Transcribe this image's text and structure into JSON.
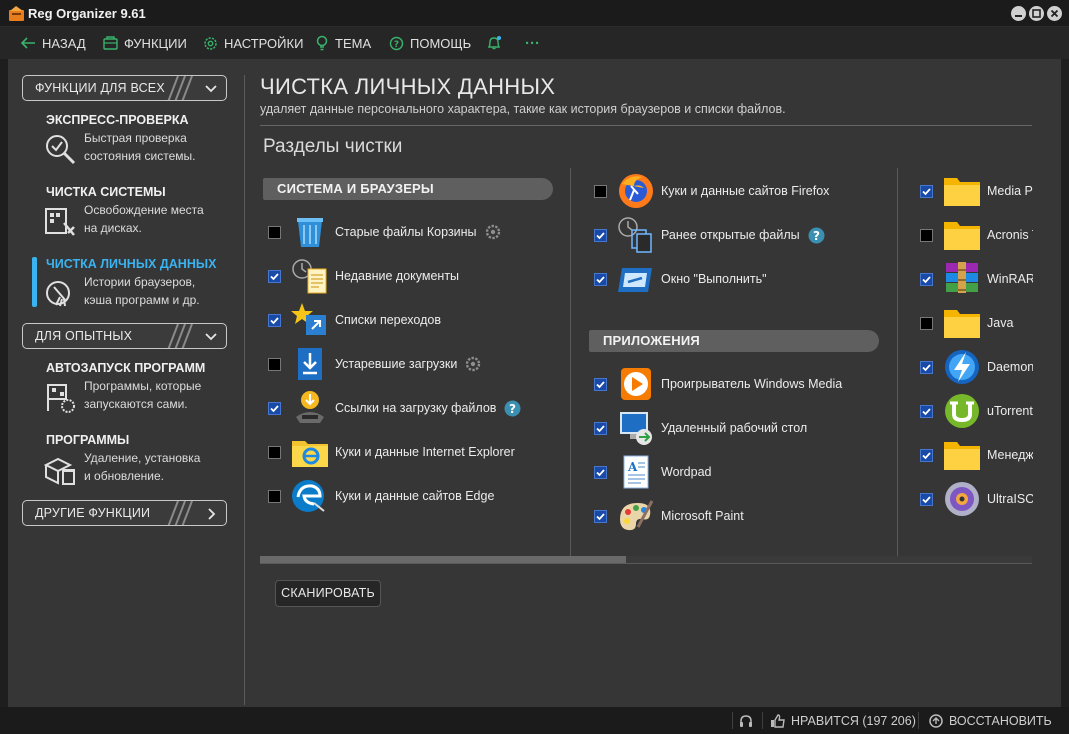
{
  "window": {
    "title": "Reg Organizer 9.61"
  },
  "toolbar": {
    "back": "НАЗАД",
    "functions": "ФУНКЦИИ",
    "settings": "НАСТРОЙКИ",
    "theme": "ТЕМА",
    "help": "ПОМОЩЬ",
    "more": "···"
  },
  "sidebar": {
    "section_all": "ФУНКЦИИ ДЛЯ ВСЕХ",
    "section_experienced": "ДЛЯ ОПЫТНЫХ",
    "section_other": "ДРУГИЕ ФУНКЦИИ",
    "items": [
      {
        "title": "ЭКСПРЕСС-ПРОВЕРКА",
        "desc1": "Быстрая проверка",
        "desc2": "состояния системы."
      },
      {
        "title": "ЧИСТКА СИСТЕМЫ",
        "desc1": "Освобождение места",
        "desc2": "на дисках."
      },
      {
        "title": "ЧИСТКА ЛИЧНЫХ ДАННЫХ",
        "desc1": "Истории браузеров,",
        "desc2": "кэша программ и др."
      },
      {
        "title": "АВТОЗАПУСК ПРОГРАММ",
        "desc1": "Программы, которые",
        "desc2": "запускаются сами."
      },
      {
        "title": "ПРОГРАММЫ",
        "desc1": "Удаление, установка",
        "desc2": "и обновление."
      }
    ]
  },
  "main": {
    "title": "ЧИСТКА ЛИЧНЫХ ДАННЫХ",
    "subtitle": "удаляет данные персонального характера, такие как история браузеров и списки файлов.",
    "sections_heading": "Разделы чистки",
    "group_system": "СИСТЕМА И БРАУЗЕРЫ",
    "group_apps": "ПРИЛОЖЕНИЯ",
    "col1": [
      {
        "label": "Старые файлы Корзины",
        "checked": false,
        "icon": "recycle-bin-icon"
      },
      {
        "label": "Недавние документы",
        "checked": true,
        "icon": "recent-docs-icon"
      },
      {
        "label": "Списки переходов",
        "checked": true,
        "icon": "jump-list-icon"
      },
      {
        "label": "Устаревшие загрузки",
        "checked": false,
        "icon": "downloads-icon"
      },
      {
        "label": "Ссылки на загрузку файлов",
        "checked": true,
        "icon": "download-links-icon"
      },
      {
        "label": "Куки и данные Internet Explorer",
        "checked": false,
        "icon": "ie-folder-icon"
      },
      {
        "label": "Куки и данные сайтов Edge",
        "checked": false,
        "icon": "edge-icon"
      }
    ],
    "col2_top": [
      {
        "label": "Куки и данные сайтов Firefox",
        "checked": false,
        "icon": "firefox-icon"
      },
      {
        "label": "Ранее открытые файлы",
        "checked": true,
        "icon": "opened-files-icon"
      },
      {
        "label": "Окно \"Выполнить\"",
        "checked": true,
        "icon": "run-dialog-icon"
      }
    ],
    "col2_apps": [
      {
        "label": "Проигрыватель Windows Media",
        "checked": true,
        "icon": "wmp-icon"
      },
      {
        "label": "Удаленный рабочий стол",
        "checked": true,
        "icon": "remote-desktop-icon"
      },
      {
        "label": "Wordpad",
        "checked": true,
        "icon": "wordpad-icon"
      },
      {
        "label": "Microsoft Paint",
        "checked": true,
        "icon": "paint-icon"
      }
    ],
    "col3": [
      {
        "label": "Media Pla",
        "checked": true,
        "icon": "folder-icon"
      },
      {
        "label": "Acronis Tr",
        "checked": false,
        "icon": "folder-icon"
      },
      {
        "label": "WinRAR",
        "checked": true,
        "icon": "winrar-icon"
      },
      {
        "label": "Java",
        "checked": false,
        "icon": "folder-icon"
      },
      {
        "label": "Daemon T",
        "checked": true,
        "icon": "daemon-tools-icon"
      },
      {
        "label": "uTorrent",
        "checked": true,
        "icon": "utorrent-icon"
      },
      {
        "label": "Менедже",
        "checked": true,
        "icon": "folder-icon"
      },
      {
        "label": "UltraISO",
        "checked": true,
        "icon": "ultraiso-icon"
      }
    ],
    "scan_button": "СКАНИРОВАТЬ"
  },
  "statusbar": {
    "like": "НРАВИТСЯ (197 206)",
    "restore": "ВОССТАНОВИТЬ"
  },
  "colors": {
    "accent": "#3ab3f0",
    "background": "#363636",
    "checkbox_on": "#1a4aa8"
  }
}
